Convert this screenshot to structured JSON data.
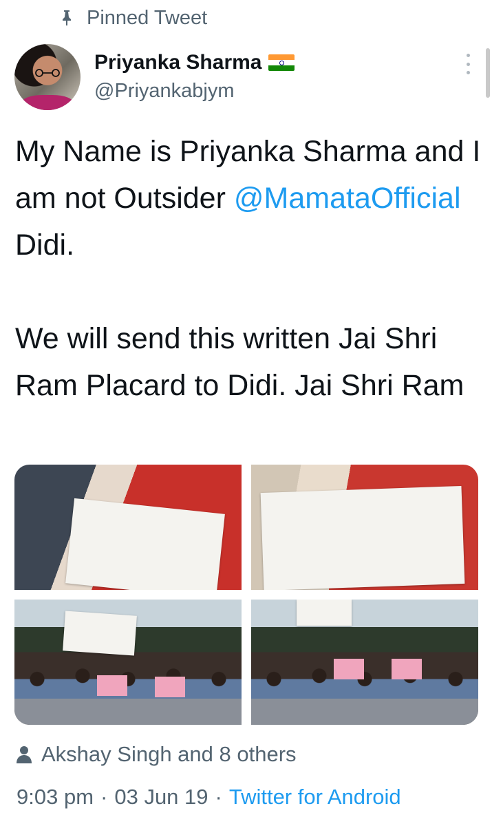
{
  "pinned": {
    "label": "Pinned Tweet",
    "icon": "pin-icon"
  },
  "author": {
    "name": "Priyanka Sharma",
    "flag_emoji": "india-flag-icon",
    "handle": "@Priyankabjym"
  },
  "tweet": {
    "line1": "My Name is Priyanka Sharma and I am not Outsider ",
    "mention": "@MamataOfficial",
    "line2": " Didi.\n\nWe will send this written Jai Shri Ram Placard to Didi. Jai Shri Ram"
  },
  "media": {
    "photos": [
      {
        "alt": "photo-1",
        "caption": ""
      },
      {
        "alt": "photo-2",
        "caption": ""
      },
      {
        "alt": "photo-3",
        "caption": ""
      },
      {
        "alt": "photo-4",
        "caption": ""
      }
    ]
  },
  "liked_by": "Akshay Singh and 8 others",
  "meta": {
    "time": "9:03 pm",
    "separator": "·",
    "date": "03 Jun 19",
    "source": "Twitter for Android"
  },
  "colors": {
    "accent": "#1d9bf0",
    "muted": "#536471",
    "text": "#0f1419"
  }
}
